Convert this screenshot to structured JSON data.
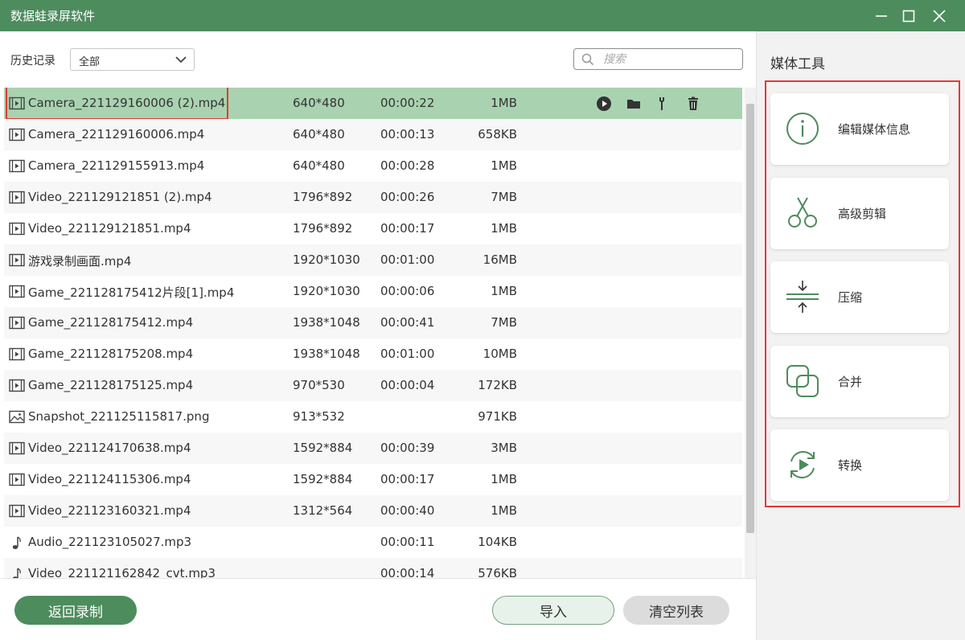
{
  "window": {
    "title": "数据蛙录屏软件"
  },
  "toolbar": {
    "history_label": "历史记录",
    "filter_value": "全部",
    "search_placeholder": "搜索"
  },
  "files": [
    {
      "name": "Camera_221129160006 (2).mp4",
      "resolution": "640*480",
      "duration": "00:00:22",
      "size": "1MB",
      "type": "video",
      "selected": true
    },
    {
      "name": "Camera_221129160006.mp4",
      "resolution": "640*480",
      "duration": "00:00:13",
      "size": "658KB",
      "type": "video"
    },
    {
      "name": "Camera_221129155913.mp4",
      "resolution": "640*480",
      "duration": "00:00:28",
      "size": "1MB",
      "type": "video"
    },
    {
      "name": "Video_221129121851 (2).mp4",
      "resolution": "1796*892",
      "duration": "00:00:26",
      "size": "7MB",
      "type": "video"
    },
    {
      "name": "Video_221129121851.mp4",
      "resolution": "1796*892",
      "duration": "00:00:17",
      "size": "1MB",
      "type": "video"
    },
    {
      "name": "游戏录制画面.mp4",
      "resolution": "1920*1030",
      "duration": "00:01:00",
      "size": "16MB",
      "type": "video"
    },
    {
      "name": "Game_221128175412片段[1].mp4",
      "resolution": "1920*1030",
      "duration": "00:00:06",
      "size": "1MB",
      "type": "video"
    },
    {
      "name": "Game_221128175412.mp4",
      "resolution": "1938*1048",
      "duration": "00:00:41",
      "size": "7MB",
      "type": "video"
    },
    {
      "name": "Game_221128175208.mp4",
      "resolution": "1938*1048",
      "duration": "00:01:00",
      "size": "10MB",
      "type": "video"
    },
    {
      "name": "Game_221128175125.mp4",
      "resolution": "970*530",
      "duration": "00:00:04",
      "size": "172KB",
      "type": "video"
    },
    {
      "name": "Snapshot_221125115817.png",
      "resolution": "913*532",
      "duration": "",
      "size": "971KB",
      "type": "image"
    },
    {
      "name": "Video_221124170638.mp4",
      "resolution": "1592*884",
      "duration": "00:00:39",
      "size": "3MB",
      "type": "video"
    },
    {
      "name": "Video_221124115306.mp4",
      "resolution": "1592*884",
      "duration": "00:00:17",
      "size": "1MB",
      "type": "video"
    },
    {
      "name": "Video_221123160321.mp4",
      "resolution": "1312*564",
      "duration": "00:00:40",
      "size": "1MB",
      "type": "video"
    },
    {
      "name": "Audio_221123105027.mp3",
      "resolution": "",
      "duration": "00:00:11",
      "size": "104KB",
      "type": "audio"
    },
    {
      "name": "Video_221121162842_cvt.mp3",
      "resolution": "",
      "duration": "00:00:14",
      "size": "576KB",
      "type": "audio"
    }
  ],
  "row_actions": [
    "play-icon",
    "folder-icon",
    "wrench-icon",
    "trash-icon"
  ],
  "buttons": {
    "back": "返回录制",
    "import": "导入",
    "clear": "清空列表"
  },
  "side": {
    "title": "媒体工具",
    "tools": [
      {
        "label": "编辑媒体信息",
        "icon": "info-icon"
      },
      {
        "label": "高级剪辑",
        "icon": "scissors-icon"
      },
      {
        "label": "压缩",
        "icon": "compress-icon"
      },
      {
        "label": "合并",
        "icon": "merge-icon"
      },
      {
        "label": "转换",
        "icon": "convert-icon"
      }
    ]
  },
  "colors": {
    "brand": "#4d8c5d",
    "selected_row": "#a9d3b0",
    "highlight_outline": "#e53935"
  }
}
